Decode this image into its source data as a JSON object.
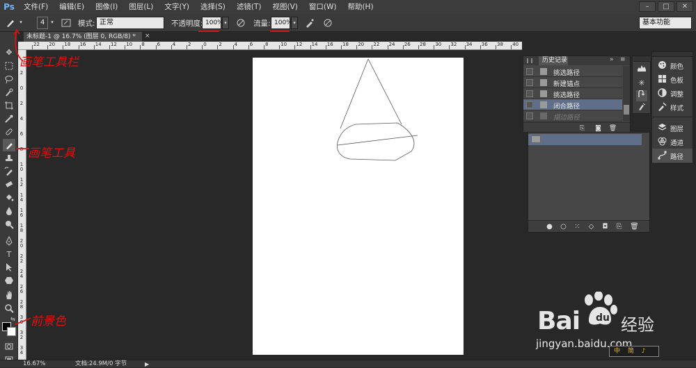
{
  "app": {
    "logo": "Ps"
  },
  "menu": [
    "文件(F)",
    "编辑(E)",
    "图像(I)",
    "图层(L)",
    "文字(Y)",
    "选择(S)",
    "滤镜(T)",
    "视图(V)",
    "窗口(W)",
    "帮助(H)"
  ],
  "window_controls": [
    "–",
    "□",
    "✕"
  ],
  "options": {
    "brush_size": "4",
    "mode_label": "模式:",
    "mode_value": "正常",
    "opacity_label": "不透明度:",
    "opacity_value": "100%",
    "flow_label": "流量:",
    "flow_value": "100%",
    "workspace": "基本功能"
  },
  "document_tab": {
    "title": "未标题-1 @ 16.7% (图层 0, RGB/8) *",
    "close": "×"
  },
  "ruler_top": [
    "22",
    "20",
    "18",
    "16",
    "14",
    "12",
    "10",
    "8",
    "6",
    "4",
    "2",
    "0",
    "2",
    "4",
    "6",
    "8",
    "10",
    "12",
    "14",
    "16",
    "18",
    "20",
    "22",
    "24",
    "26",
    "28",
    "30",
    "32",
    "34",
    "36",
    "38",
    "40",
    "42",
    "44"
  ],
  "ruler_left": [
    "2",
    "0",
    "2",
    "4",
    "6",
    "8",
    "1 0",
    "1 2",
    "1 4",
    "1 6",
    "1 8",
    "2 0",
    "2 2",
    "2 4",
    "2 6",
    "2 8",
    "3 0",
    "3 2",
    "3 4",
    "3 6",
    "3 8"
  ],
  "history_panel": {
    "tab": "历史记录",
    "items": [
      {
        "label": "挑选路径",
        "state": "normal"
      },
      {
        "label": "新建锚点",
        "state": "normal"
      },
      {
        "label": "挑选路径",
        "state": "normal"
      },
      {
        "label": "闭合路径",
        "state": "selected"
      },
      {
        "label": "描边路径",
        "state": "disabled"
      }
    ]
  },
  "right_dock": {
    "items": [
      {
        "label": "颜色",
        "icon": "palette-icon"
      },
      {
        "label": "色板",
        "icon": "swatches-icon"
      },
      {
        "label": "调整",
        "icon": "adjustments-icon"
      },
      {
        "label": "样式",
        "icon": "styles-icon"
      },
      {
        "label": "图层",
        "icon": "layers-icon"
      },
      {
        "label": "通道",
        "icon": "channels-icon"
      },
      {
        "label": "路径",
        "icon": "paths-icon"
      }
    ]
  },
  "status": {
    "zoom": "16.67%",
    "doc": "文档:24.9M/0 字节"
  },
  "annotations": {
    "options_bar": "画笔工具栏",
    "brush_tool": "画笔工具",
    "foreground": "前景色"
  },
  "watermark": {
    "brand": "Bai",
    "cn": "经验",
    "url": "jingyan.baidu.com"
  },
  "ime": "中 简 ♪"
}
